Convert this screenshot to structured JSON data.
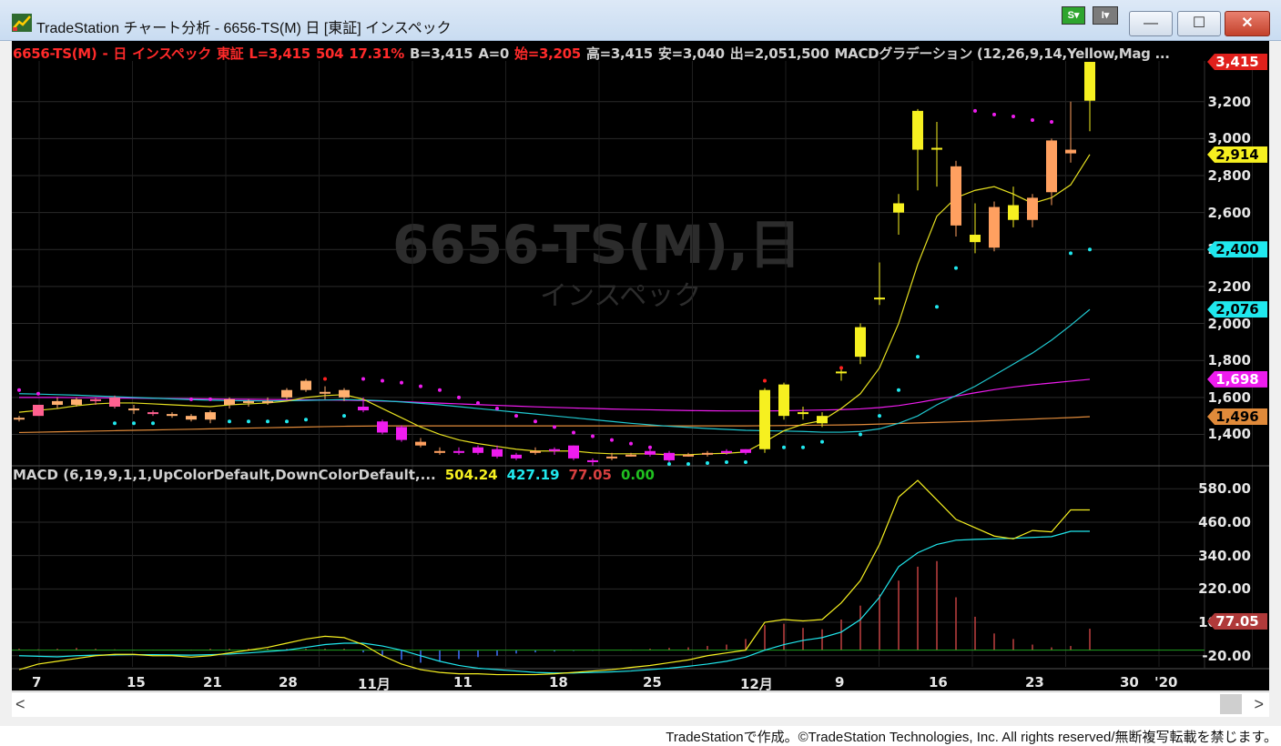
{
  "window": {
    "title": "TradeStation チャート分析 - 6656-TS(M) 日 [東証] インスペック",
    "s_button": "S",
    "i_button": "I",
    "minimize": "—",
    "maximize": "☐",
    "close": "✕"
  },
  "status": {
    "symbol": "6656-TS(M)",
    "sep": "-",
    "interval": "日",
    "name": "インスペック",
    "exchange": "東証",
    "last": "L=3,415",
    "change": "504",
    "change_pct": "17.31%",
    "bid": "B=3,415",
    "ask": "A=0",
    "open": "始=3,205",
    "high": "高=3,415",
    "low": "安=3,040",
    "volume": "出=2,051,500",
    "indicator": "MACDグラデーション (12,26,9,14,Yellow,Mag ..."
  },
  "watermark": {
    "symbol": "6656-TS(M),日",
    "name": "インスペック"
  },
  "price_axis": {
    "ticks": [
      "3,200",
      "3,000",
      "2,800",
      "2,600",
      "2,400",
      "2,200",
      "2,000",
      "1,800",
      "1,600",
      "1,400"
    ],
    "badges": [
      {
        "label": "3,415",
        "color": "#e0201c",
        "text": "#ffffff"
      },
      {
        "label": "2,914",
        "color": "#f6f020",
        "text": "#000000"
      },
      {
        "label": "2,400",
        "color": "#20e8ee",
        "text": "#000000"
      },
      {
        "label": "2,076",
        "color": "#20e8ee",
        "text": "#000000"
      },
      {
        "label": "1,698",
        "color": "#ee1cee",
        "text": "#ffffff"
      },
      {
        "label": "1,496",
        "color": "#e08a3a",
        "text": "#000000"
      }
    ]
  },
  "macd": {
    "label": "MACD (6,19,9,1,1,UpColorDefault,DownColorDefault,...",
    "macd_value": "504.24",
    "signal_value": "427.19",
    "hist_value": "77.05",
    "zero_value": "0.00",
    "ticks": [
      "580.00",
      "460.00",
      "340.00",
      "220.00",
      "100.00",
      "-20.00"
    ],
    "badge": "77.05"
  },
  "x_axis": {
    "labels": [
      "7",
      "15",
      "21",
      "28",
      "11月",
      "11",
      "18",
      "25",
      "12月",
      "9",
      "16",
      "23",
      "30",
      "'20"
    ]
  },
  "scroll": {
    "left": "<",
    "right": ">"
  },
  "footer": "TradeStationで作成。©TradeStation Technologies, Inc. All rights reserved/無断複写転載を禁じます。",
  "chart_data": {
    "type": "candlestick",
    "candles_ohlc": [
      [
        1480,
        1500,
        1470,
        1490
      ],
      [
        1560,
        1560,
        1500,
        1500
      ],
      [
        1560,
        1600,
        1540,
        1580
      ],
      [
        1560,
        1600,
        1550,
        1590
      ],
      [
        1590,
        1600,
        1560,
        1580
      ],
      [
        1600,
        1610,
        1540,
        1550
      ],
      [
        1530,
        1560,
        1510,
        1540
      ],
      [
        1520,
        1530,
        1500,
        1510
      ],
      [
        1500,
        1520,
        1490,
        1510
      ],
      [
        1480,
        1510,
        1470,
        1500
      ],
      [
        1480,
        1530,
        1460,
        1520
      ],
      [
        1560,
        1600,
        1540,
        1590
      ],
      [
        1570,
        1590,
        1550,
        1580
      ],
      [
        1580,
        1600,
        1560,
        1580
      ],
      [
        1600,
        1650,
        1590,
        1640
      ],
      [
        1640,
        1700,
        1630,
        1690
      ],
      [
        1620,
        1660,
        1590,
        1630
      ],
      [
        1600,
        1650,
        1580,
        1640
      ],
      [
        1550,
        1600,
        1520,
        1530
      ],
      [
        1470,
        1480,
        1400,
        1410
      ],
      [
        1440,
        1450,
        1360,
        1370
      ],
      [
        1340,
        1380,
        1330,
        1360
      ],
      [
        1300,
        1330,
        1290,
        1310
      ],
      [
        1310,
        1330,
        1290,
        1300
      ],
      [
        1330,
        1340,
        1290,
        1300
      ],
      [
        1320,
        1340,
        1270,
        1280
      ],
      [
        1290,
        1300,
        1260,
        1270
      ],
      [
        1300,
        1330,
        1290,
        1310
      ],
      [
        1320,
        1330,
        1290,
        1310
      ],
      [
        1340,
        1340,
        1260,
        1270
      ],
      [
        1260,
        1270,
        1230,
        1250
      ],
      [
        1270,
        1300,
        1260,
        1280
      ],
      [
        1290,
        1300,
        1280,
        1290
      ],
      [
        1310,
        1320,
        1280,
        1290
      ],
      [
        1300,
        1310,
        1250,
        1260
      ],
      [
        1290,
        1300,
        1280,
        1290
      ],
      [
        1290,
        1310,
        1280,
        1300
      ],
      [
        1310,
        1320,
        1290,
        1300
      ],
      [
        1320,
        1320,
        1290,
        1300
      ],
      [
        1320,
        1650,
        1300,
        1640
      ],
      [
        1500,
        1680,
        1480,
        1670
      ],
      [
        1510,
        1550,
        1480,
        1520
      ],
      [
        1460,
        1520,
        1440,
        1500
      ],
      [
        1740,
        1760,
        1690,
        1740
      ],
      [
        1820,
        2000,
        1780,
        1980
      ],
      [
        2130,
        2330,
        2100,
        2140
      ],
      [
        2600,
        2700,
        2480,
        2650
      ],
      [
        2940,
        3160,
        2720,
        3150
      ],
      [
        2940,
        3090,
        2740,
        2950
      ],
      [
        2850,
        2880,
        2470,
        2530
      ],
      [
        2440,
        2650,
        2380,
        2480
      ],
      [
        2630,
        2660,
        2390,
        2410
      ],
      [
        2560,
        2740,
        2520,
        2640
      ],
      [
        2680,
        2700,
        2520,
        2560
      ],
      [
        2990,
        3000,
        2640,
        2710
      ],
      [
        2940,
        3200,
        2870,
        2920
      ],
      [
        3205,
        3415,
        3040,
        3415
      ]
    ],
    "price_range": [
      1240,
      3420
    ],
    "ema_yellow": [
      1520,
      1530,
      1540,
      1555,
      1565,
      1570,
      1570,
      1565,
      1560,
      1555,
      1550,
      1560,
      1565,
      1570,
      1580,
      1600,
      1610,
      1615,
      1590,
      1540,
      1490,
      1440,
      1400,
      1370,
      1350,
      1335,
      1320,
      1310,
      1310,
      1310,
      1300,
      1295,
      1295,
      1295,
      1290,
      1290,
      1295,
      1298,
      1305,
      1360,
      1420,
      1455,
      1475,
      1540,
      1620,
      1760,
      2000,
      2320,
      2580,
      2680,
      2720,
      2740,
      2700,
      2650,
      2680,
      2750,
      2914
    ],
    "ema_cyan": [
      1620,
      1618,
      1615,
      1612,
      1608,
      1604,
      1600,
      1596,
      1592,
      1588,
      1585,
      1583,
      1582,
      1581,
      1582,
      1584,
      1586,
      1588,
      1586,
      1582,
      1576,
      1568,
      1560,
      1550,
      1540,
      1530,
      1520,
      1510,
      1500,
      1490,
      1480,
      1470,
      1460,
      1452,
      1444,
      1438,
      1432,
      1427,
      1422,
      1420,
      1418,
      1416,
      1412,
      1412,
      1416,
      1430,
      1460,
      1500,
      1560,
      1610,
      1660,
      1720,
      1780,
      1840,
      1910,
      1990,
      2076
    ],
    "ma_magenta": [
      1600,
      1600,
      1600,
      1599,
      1598,
      1597,
      1596,
      1595,
      1594,
      1593,
      1592,
      1591,
      1590,
      1589,
      1588,
      1587,
      1586,
      1585,
      1583,
      1580,
      1577,
      1573,
      1569,
      1565,
      1561,
      1557,
      1553,
      1549,
      1546,
      1543,
      1540,
      1537,
      1535,
      1533,
      1531,
      1529,
      1528,
      1527,
      1527,
      1527,
      1528,
      1530,
      1532,
      1534,
      1538,
      1545,
      1556,
      1572,
      1590,
      1607,
      1625,
      1642,
      1656,
      1668,
      1678,
      1688,
      1698
    ],
    "ma_orange": [
      1410,
      1412,
      1414,
      1416,
      1418,
      1420,
      1422,
      1424,
      1426,
      1428,
      1430,
      1432,
      1434,
      1436,
      1438,
      1440,
      1442,
      1444,
      1445,
      1446,
      1446,
      1446,
      1446,
      1446,
      1446,
      1446,
      1446,
      1446,
      1446,
      1446,
      1446,
      1446,
      1446,
      1446,
      1446,
      1446,
      1446,
      1446,
      1446,
      1447,
      1448,
      1449,
      1450,
      1451,
      1453,
      1456,
      1459,
      1462,
      1465,
      1468,
      1471,
      1475,
      1479,
      1483,
      1487,
      1491,
      1496
    ],
    "sar_dots": [
      [
        0,
        1640,
        "#ee1cee"
      ],
      [
        1,
        1620,
        "#ee1cee"
      ],
      [
        5,
        1460,
        "#20e8ee"
      ],
      [
        6,
        1460,
        "#20e8ee"
      ],
      [
        7,
        1460,
        "#20e8ee"
      ],
      [
        9,
        1590,
        "#ee1cee"
      ],
      [
        10,
        1590,
        "#ee1cee"
      ],
      [
        11,
        1470,
        "#20e8ee"
      ],
      [
        12,
        1470,
        "#20e8ee"
      ],
      [
        13,
        1470,
        "#20e8ee"
      ],
      [
        14,
        1470,
        "#20e8ee"
      ],
      [
        15,
        1480,
        "#20e8ee"
      ],
      [
        16,
        1700,
        "#ff2020"
      ],
      [
        17,
        1500,
        "#20e8ee"
      ],
      [
        18,
        1700,
        "#ee1cee"
      ],
      [
        19,
        1690,
        "#ee1cee"
      ],
      [
        20,
        1680,
        "#ee1cee"
      ],
      [
        21,
        1660,
        "#ee1cee"
      ],
      [
        22,
        1640,
        "#ee1cee"
      ],
      [
        23,
        1600,
        "#ee1cee"
      ],
      [
        24,
        1570,
        "#ee1cee"
      ],
      [
        25,
        1540,
        "#ee1cee"
      ],
      [
        26,
        1500,
        "#ee1cee"
      ],
      [
        27,
        1470,
        "#ee1cee"
      ],
      [
        28,
        1440,
        "#ee1cee"
      ],
      [
        29,
        1410,
        "#ee1cee"
      ],
      [
        30,
        1390,
        "#ee1cee"
      ],
      [
        31,
        1370,
        "#ee1cee"
      ],
      [
        32,
        1350,
        "#ee1cee"
      ],
      [
        33,
        1330,
        "#ee1cee"
      ],
      [
        34,
        1240,
        "#20e8ee"
      ],
      [
        35,
        1240,
        "#20e8ee"
      ],
      [
        36,
        1245,
        "#20e8ee"
      ],
      [
        37,
        1250,
        "#20e8ee"
      ],
      [
        38,
        1250,
        "#20e8ee"
      ],
      [
        39,
        1690,
        "#ff2020"
      ],
      [
        40,
        1330,
        "#20e8ee"
      ],
      [
        41,
        1330,
        "#20e8ee"
      ],
      [
        42,
        1360,
        "#20e8ee"
      ],
      [
        43,
        1760,
        "#ff2020"
      ],
      [
        44,
        1400,
        "#20e8ee"
      ],
      [
        45,
        1500,
        "#20e8ee"
      ],
      [
        46,
        1640,
        "#20e8ee"
      ],
      [
        47,
        1820,
        "#20e8ee"
      ],
      [
        48,
        2090,
        "#20e8ee"
      ],
      [
        49,
        2300,
        "#20e8ee"
      ],
      [
        50,
        3150,
        "#ee1cee"
      ],
      [
        51,
        3130,
        "#ee1cee"
      ],
      [
        52,
        3120,
        "#ee1cee"
      ],
      [
        53,
        3100,
        "#ee1cee"
      ],
      [
        54,
        3090,
        "#ee1cee"
      ],
      [
        55,
        2380,
        "#20e8ee"
      ],
      [
        56,
        2400,
        "#20e8ee"
      ]
    ],
    "macd_range": [
      -60,
      620
    ],
    "macd_line": [
      -70,
      -50,
      -40,
      -30,
      -20,
      -15,
      -15,
      -20,
      -20,
      -25,
      -20,
      -10,
      0,
      10,
      25,
      40,
      50,
      45,
      20,
      -20,
      -50,
      -70,
      -80,
      -85,
      -85,
      -88,
      -88,
      -88,
      -85,
      -80,
      -75,
      -70,
      -62,
      -55,
      -45,
      -35,
      -20,
      -10,
      0,
      100,
      110,
      105,
      110,
      170,
      250,
      380,
      550,
      610,
      540,
      470,
      440,
      410,
      400,
      430,
      425,
      504,
      504
    ],
    "signal_line": [
      -20,
      -22,
      -24,
      -20,
      -18,
      -17,
      -16,
      -16,
      -17,
      -18,
      -16,
      -14,
      -10,
      -5,
      0,
      10,
      20,
      25,
      25,
      15,
      0,
      -20,
      -40,
      -55,
      -65,
      -70,
      -75,
      -80,
      -82,
      -82,
      -80,
      -78,
      -75,
      -70,
      -65,
      -58,
      -50,
      -40,
      -25,
      0,
      20,
      35,
      45,
      65,
      110,
      190,
      300,
      350,
      380,
      395,
      398,
      400,
      402,
      405,
      408,
      427,
      427
    ],
    "hist": [
      5,
      3,
      5,
      8,
      5,
      3,
      2,
      1,
      1,
      2,
      5,
      5,
      5,
      5,
      5,
      5,
      5,
      5,
      -8,
      -22,
      -35,
      -45,
      -40,
      -32,
      -25,
      -20,
      -12,
      -8,
      -5,
      -3,
      -2,
      -1,
      2,
      5,
      8,
      10,
      15,
      20,
      40,
      90,
      95,
      80,
      75,
      110,
      160,
      200,
      250,
      300,
      320,
      190,
      120,
      60,
      40,
      20,
      10,
      15,
      77
    ]
  }
}
